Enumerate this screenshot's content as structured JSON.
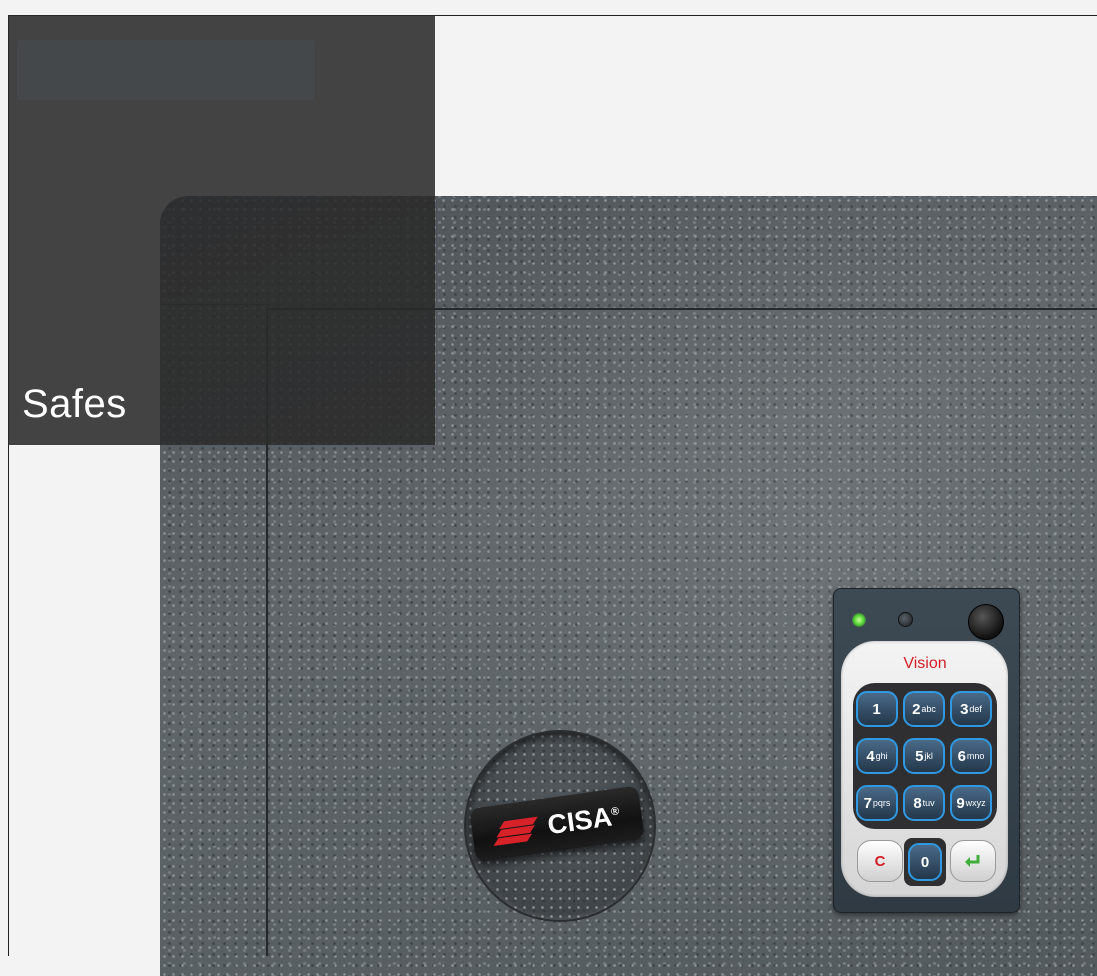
{
  "page": {
    "title": "Safes"
  },
  "brand": {
    "name": "CISA",
    "reg": "®",
    "logo_color": "#d8222a"
  },
  "keypad": {
    "model": "Vision",
    "led_status": "green",
    "keys": [
      {
        "digit": "1",
        "letters": ""
      },
      {
        "digit": "2",
        "letters": "abc"
      },
      {
        "digit": "3",
        "letters": "def"
      },
      {
        "digit": "4",
        "letters": "ghi"
      },
      {
        "digit": "5",
        "letters": "jkl"
      },
      {
        "digit": "6",
        "letters": "mno"
      },
      {
        "digit": "7",
        "letters": "pqrs"
      },
      {
        "digit": "8",
        "letters": "tuv"
      },
      {
        "digit": "9",
        "letters": "wxyz"
      }
    ],
    "clear_label": "C",
    "zero_label": "0",
    "enter_icon": "enter-arrow-icon",
    "colors": {
      "key_border": "#2f98e0",
      "clear": "#d21f26",
      "enter": "#3fae3a"
    }
  },
  "colors": {
    "overlay": "#2a2a2a",
    "safe_body": "#585e62",
    "background": "#f3f3f3"
  }
}
